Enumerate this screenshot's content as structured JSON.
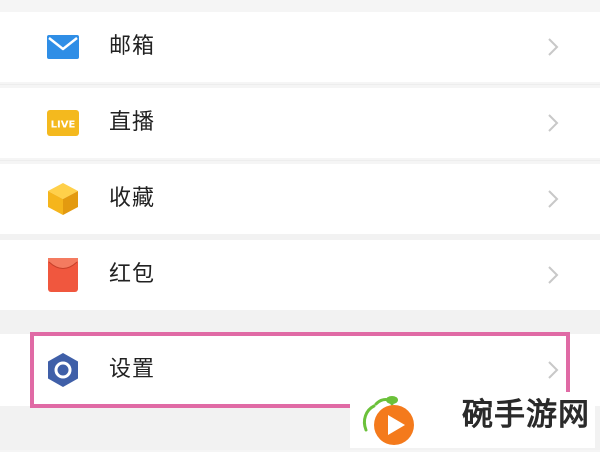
{
  "menu": {
    "items": [
      {
        "label": "邮箱",
        "icon": "mail-icon"
      },
      {
        "label": "直播",
        "icon": "live-icon"
      },
      {
        "label": "收藏",
        "icon": "favorites-cube-icon"
      },
      {
        "label": "红包",
        "icon": "red-envelope-icon"
      },
      {
        "label": "设置",
        "icon": "settings-hexagon-icon"
      }
    ]
  },
  "watermark": {
    "text": "碗手游网",
    "logo": "play-button-logo"
  },
  "colors": {
    "highlight_border": "#e06aa5",
    "mail_blue": "#2f8ee6",
    "live_yellow": "#f4b91e",
    "favorites_yellow": "#f5b51c",
    "red_envelope": "#f0573e",
    "settings_blue": "#3f5fa8",
    "watermark_orange": "#f47a1c",
    "watermark_green": "#6bc13a"
  }
}
